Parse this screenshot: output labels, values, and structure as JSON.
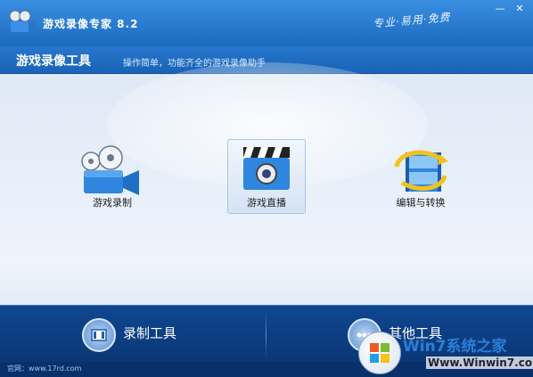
{
  "window": {
    "title": "游戏录像专家 8.2",
    "slogan": "专业·易用·免费",
    "buttons": {
      "minimize": "—",
      "close": "✕"
    }
  },
  "header": {
    "title": "游戏录像工具",
    "subtitle": "操作简单，功能齐全的游戏录像助手"
  },
  "tools": [
    {
      "label": "游戏录制",
      "icon": "video-camera-icon"
    },
    {
      "label": "游戏直播",
      "icon": "clapperboard-icon",
      "active": true
    },
    {
      "label": "编辑与转换",
      "icon": "film-edit-icon"
    }
  ],
  "bottom_tabs": [
    {
      "label": "录制工具",
      "icon": "record-tool-icon"
    },
    {
      "label": "其他工具",
      "icon": "more-icon"
    }
  ],
  "footer": {
    "text": "官网：www.17rd.com"
  },
  "watermark": {
    "title": "Win7系统之家",
    "url": "Www.Winwin7.com"
  },
  "colors": {
    "title_bar": "#1b6bc1",
    "bottom_bar": "#0a3775",
    "content_bg": "#eef4fb"
  }
}
